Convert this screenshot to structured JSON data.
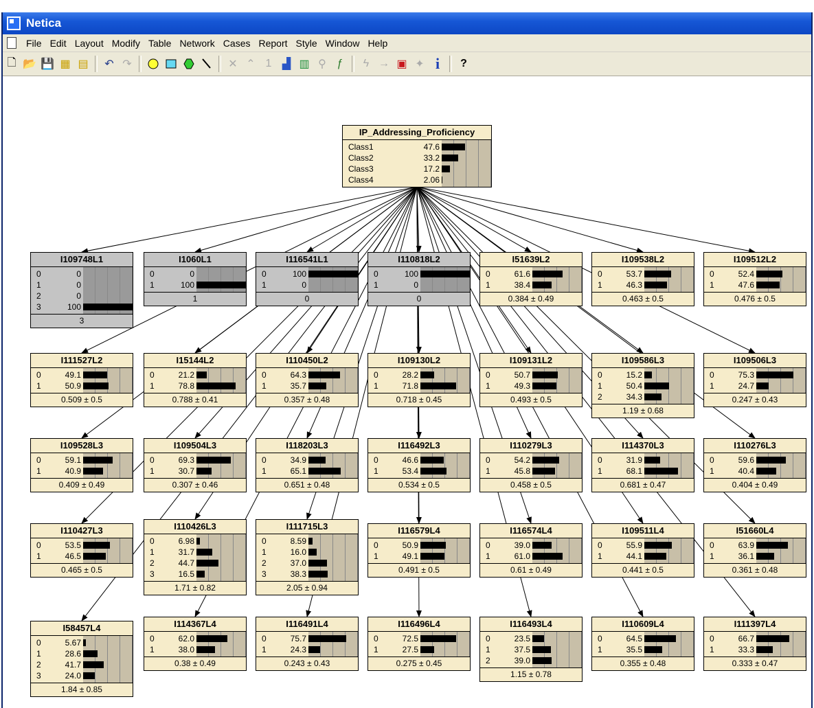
{
  "window": {
    "title": "Netica"
  },
  "menu": [
    "File",
    "Edit",
    "Layout",
    "Modify",
    "Table",
    "Network",
    "Cases",
    "Report",
    "Style",
    "Window",
    "Help"
  ],
  "toolbar_icons": [
    "new-icon",
    "open-icon",
    "save-icon",
    "compile-icon",
    "properties-icon",
    "undo-icon",
    "redo-icon",
    "add-nature-node-icon",
    "add-decision-node-icon",
    "add-utility-node-icon",
    "add-link-icon",
    "absorb-icon",
    "reverse-link-icon",
    "one-icon",
    "equation-icon",
    "table-icon",
    "find-icon",
    "function-icon",
    "lightning-icon",
    "arrow-icon",
    "optimize-icon",
    "star-icon",
    "info-icon",
    "help-icon"
  ],
  "nodes": [
    {
      "id": "IP_Addressing_Proficiency",
      "ev": false,
      "labels": [
        "Class1",
        "Class2",
        "Class3",
        "Class4"
      ],
      "values": [
        "47.6",
        "33.2",
        "17.2",
        "2.06"
      ],
      "foot": null
    },
    {
      "id": "I109748L1",
      "ev": true,
      "labels": [
        "0",
        "1",
        "2",
        "3"
      ],
      "values": [
        "0",
        "0",
        "0",
        "100"
      ],
      "foot": "3"
    },
    {
      "id": "I1060L1",
      "ev": true,
      "labels": [
        "0",
        "1"
      ],
      "values": [
        "0",
        "100"
      ],
      "foot": "1"
    },
    {
      "id": "I116541L1",
      "ev": true,
      "labels": [
        "0",
        "1"
      ],
      "values": [
        "100",
        "0"
      ],
      "foot": "0"
    },
    {
      "id": "I110818L2",
      "ev": true,
      "labels": [
        "0",
        "1"
      ],
      "values": [
        "100",
        "0"
      ],
      "foot": "0"
    },
    {
      "id": "I51639L2",
      "ev": false,
      "labels": [
        "0",
        "1"
      ],
      "values": [
        "61.6",
        "38.4"
      ],
      "foot": "0.384 ± 0.49"
    },
    {
      "id": "I109538L2",
      "ev": false,
      "labels": [
        "0",
        "1"
      ],
      "values": [
        "53.7",
        "46.3"
      ],
      "foot": "0.463 ± 0.5"
    },
    {
      "id": "I109512L2",
      "ev": false,
      "labels": [
        "0",
        "1"
      ],
      "values": [
        "52.4",
        "47.6"
      ],
      "foot": "0.476 ± 0.5"
    },
    {
      "id": "I111527L2",
      "ev": false,
      "labels": [
        "0",
        "1"
      ],
      "values": [
        "49.1",
        "50.9"
      ],
      "foot": "0.509 ± 0.5"
    },
    {
      "id": "I15144L2",
      "ev": false,
      "labels": [
        "0",
        "1"
      ],
      "values": [
        "21.2",
        "78.8"
      ],
      "foot": "0.788 ± 0.41"
    },
    {
      "id": "I110450L2",
      "ev": false,
      "labels": [
        "0",
        "1"
      ],
      "values": [
        "64.3",
        "35.7"
      ],
      "foot": "0.357 ± 0.48"
    },
    {
      "id": "I109130L2",
      "ev": false,
      "labels": [
        "0",
        "1"
      ],
      "values": [
        "28.2",
        "71.8"
      ],
      "foot": "0.718 ± 0.45"
    },
    {
      "id": "I109131L2",
      "ev": false,
      "labels": [
        "0",
        "1"
      ],
      "values": [
        "50.7",
        "49.3"
      ],
      "foot": "0.493 ± 0.5"
    },
    {
      "id": "I109586L3",
      "ev": false,
      "labels": [
        "0",
        "1",
        "2"
      ],
      "values": [
        "15.2",
        "50.4",
        "34.3"
      ],
      "foot": "1.19 ± 0.68"
    },
    {
      "id": "I109506L3",
      "ev": false,
      "labels": [
        "0",
        "1"
      ],
      "values": [
        "75.3",
        "24.7"
      ],
      "foot": "0.247 ± 0.43"
    },
    {
      "id": "I109528L3",
      "ev": false,
      "labels": [
        "0",
        "1"
      ],
      "values": [
        "59.1",
        "40.9"
      ],
      "foot": "0.409 ± 0.49"
    },
    {
      "id": "I109504L3",
      "ev": false,
      "labels": [
        "0",
        "1"
      ],
      "values": [
        "69.3",
        "30.7"
      ],
      "foot": "0.307 ± 0.46"
    },
    {
      "id": "I118203L3",
      "ev": false,
      "labels": [
        "0",
        "1"
      ],
      "values": [
        "34.9",
        "65.1"
      ],
      "foot": "0.651 ± 0.48"
    },
    {
      "id": "I116492L3",
      "ev": false,
      "labels": [
        "0",
        "1"
      ],
      "values": [
        "46.6",
        "53.4"
      ],
      "foot": "0.534 ± 0.5"
    },
    {
      "id": "I110279L3",
      "ev": false,
      "labels": [
        "0",
        "1"
      ],
      "values": [
        "54.2",
        "45.8"
      ],
      "foot": "0.458 ± 0.5"
    },
    {
      "id": "I114370L3",
      "ev": false,
      "labels": [
        "0",
        "1"
      ],
      "values": [
        "31.9",
        "68.1"
      ],
      "foot": "0.681 ± 0.47"
    },
    {
      "id": "I110276L3",
      "ev": false,
      "labels": [
        "0",
        "1"
      ],
      "values": [
        "59.6",
        "40.4"
      ],
      "foot": "0.404 ± 0.49"
    },
    {
      "id": "I110427L3",
      "ev": false,
      "labels": [
        "0",
        "1"
      ],
      "values": [
        "53.5",
        "46.5"
      ],
      "foot": "0.465 ± 0.5"
    },
    {
      "id": "I110426L3",
      "ev": false,
      "labels": [
        "0",
        "1",
        "2",
        "3"
      ],
      "values": [
        "6.98",
        "31.7",
        "44.7",
        "16.5"
      ],
      "foot": "1.71 ± 0.82"
    },
    {
      "id": "I111715L3",
      "ev": false,
      "labels": [
        "0",
        "1",
        "2",
        "3"
      ],
      "values": [
        "8.59",
        "16.0",
        "37.0",
        "38.3"
      ],
      "foot": "2.05 ± 0.94"
    },
    {
      "id": "I116579L4",
      "ev": false,
      "labels": [
        "0",
        "1"
      ],
      "values": [
        "50.9",
        "49.1"
      ],
      "foot": "0.491 ± 0.5"
    },
    {
      "id": "I116574L4",
      "ev": false,
      "labels": [
        "0",
        "1"
      ],
      "values": [
        "39.0",
        "61.0"
      ],
      "foot": "0.61 ± 0.49"
    },
    {
      "id": "I109511L4",
      "ev": false,
      "labels": [
        "0",
        "1"
      ],
      "values": [
        "55.9",
        "44.1"
      ],
      "foot": "0.441 ± 0.5"
    },
    {
      "id": "I51660L4",
      "ev": false,
      "labels": [
        "0",
        "1"
      ],
      "values": [
        "63.9",
        "36.1"
      ],
      "foot": "0.361 ± 0.48"
    },
    {
      "id": "I58457L4",
      "ev": false,
      "labels": [
        "0",
        "1",
        "2",
        "3"
      ],
      "values": [
        "5.67",
        "28.6",
        "41.7",
        "24.0"
      ],
      "foot": "1.84 ± 0.85"
    },
    {
      "id": "I114367L4",
      "ev": false,
      "labels": [
        "0",
        "1"
      ],
      "values": [
        "62.0",
        "38.0"
      ],
      "foot": "0.38 ± 0.49"
    },
    {
      "id": "I116491L4",
      "ev": false,
      "labels": [
        "0",
        "1"
      ],
      "values": [
        "75.7",
        "24.3"
      ],
      "foot": "0.243 ± 0.43"
    },
    {
      "id": "I116496L4",
      "ev": false,
      "labels": [
        "0",
        "1"
      ],
      "values": [
        "72.5",
        "27.5"
      ],
      "foot": "0.275 ± 0.45"
    },
    {
      "id": "I116493L4",
      "ev": false,
      "labels": [
        "0",
        "1",
        "2"
      ],
      "values": [
        "23.5",
        "37.5",
        "39.0"
      ],
      "foot": "1.15 ± 0.78"
    },
    {
      "id": "I110609L4",
      "ev": false,
      "labels": [
        "0",
        "1"
      ],
      "values": [
        "64.5",
        "35.5"
      ],
      "foot": "0.355 ± 0.48"
    },
    {
      "id": "I111397L4",
      "ev": false,
      "labels": [
        "0",
        "1"
      ],
      "values": [
        "66.7",
        "33.3"
      ],
      "foot": "0.333 ± 0.47"
    }
  ]
}
